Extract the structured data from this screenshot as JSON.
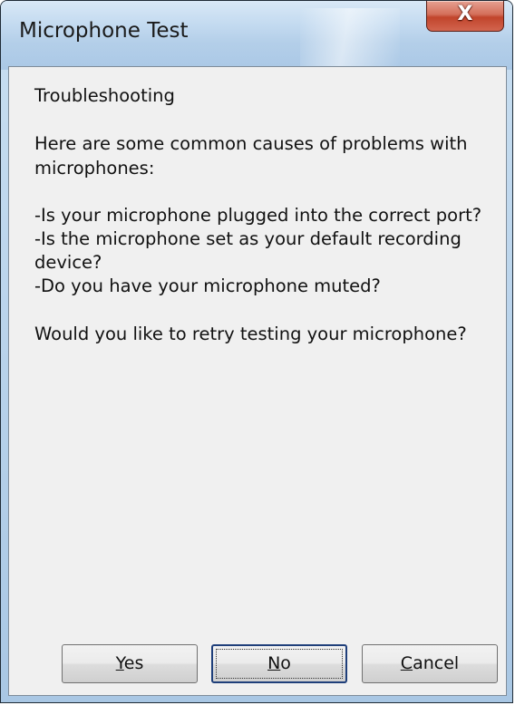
{
  "window": {
    "title": "Microphone Test",
    "close_glyph": "X"
  },
  "content": {
    "heading": "Troubleshooting",
    "intro_line1": "Here are some common causes of problems with",
    "intro_line2": "microphones:",
    "causes": [
      "-Is your microphone plugged into the correct port?",
      "-Is the microphone set as your default recording",
      "device?",
      "-Do you have your microphone muted?"
    ],
    "question": "Would you like to retry testing your microphone?"
  },
  "buttons": {
    "yes": {
      "accel": "Y",
      "rest": "es"
    },
    "no": {
      "accel": "N",
      "rest": "o"
    },
    "cancel": {
      "accel": "C",
      "rest": "ancel"
    }
  },
  "colors": {
    "title_bar": "#bcd5ec",
    "close_button": "#c1442b",
    "client_background": "#f0f0f0"
  }
}
